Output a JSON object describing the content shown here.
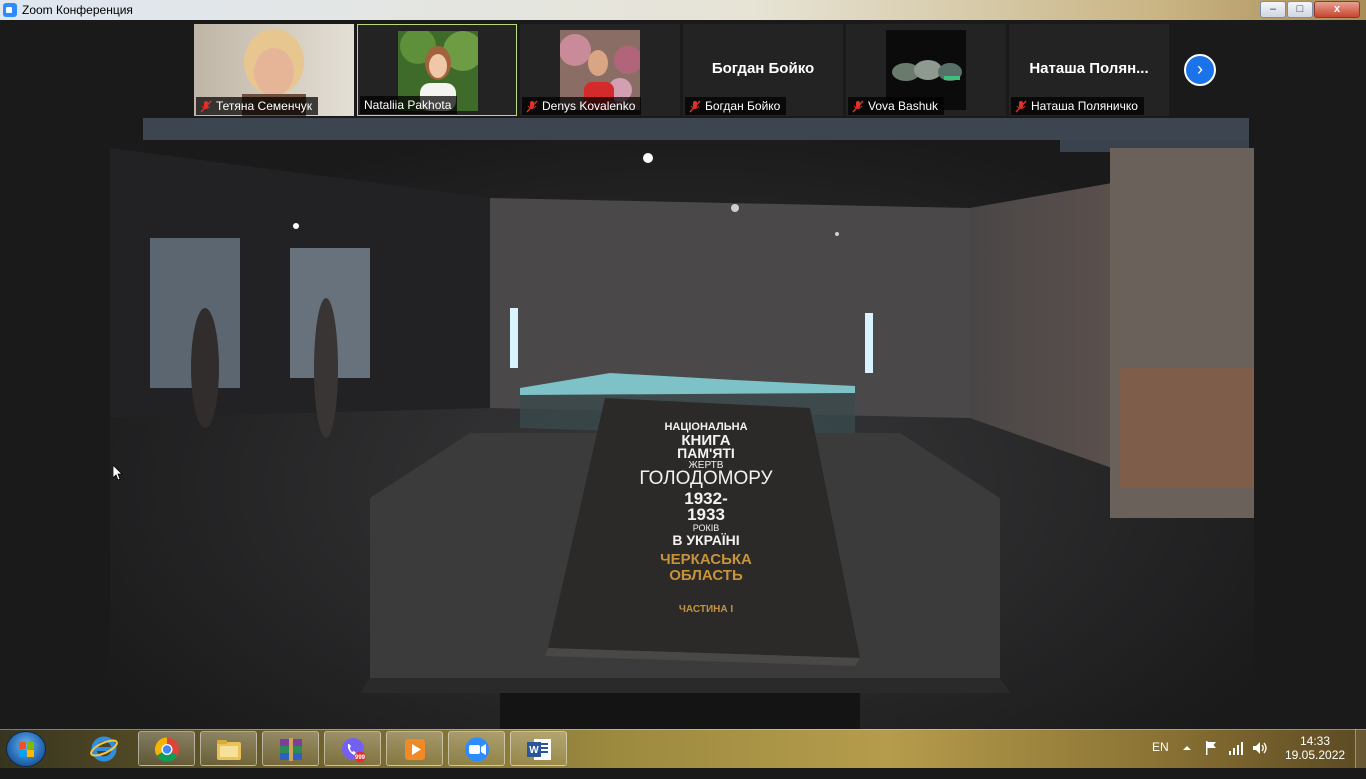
{
  "window": {
    "title": "Zoom Конференция",
    "controls": {
      "minimize": "–",
      "maximize": "□",
      "close": "x"
    }
  },
  "participants": [
    {
      "name": "Тетяна Семенчук",
      "muted": true,
      "video": "webcam"
    },
    {
      "name": "Nataliia Pakhota",
      "muted": false,
      "video": "photo",
      "active": true
    },
    {
      "name": "Denys Kovalenko",
      "muted": true,
      "video": "photo"
    },
    {
      "name": "Богдан Бойко",
      "muted": true,
      "video": "none",
      "display_name": "Богдан Бойко"
    },
    {
      "name": "Vova Bashuk",
      "muted": true,
      "video": "photo"
    },
    {
      "name": "Наташа Поляничко",
      "muted": true,
      "video": "none",
      "display_name": "Наташа  Полян..."
    }
  ],
  "gallery_next": "›",
  "shared_video": {
    "book": {
      "line1": "НАЦІОНАЛЬНА",
      "line2": "КНИГА",
      "line3": "ПАМ'ЯТІ",
      "line4": "ЖЕРТВ",
      "line5": "ГОЛОДОМОРУ",
      "line6": "1932-",
      "line7": "1933",
      "line8": "РОКІВ",
      "line9": "В УКРАЇНІ",
      "region1": "ЧЕРКАСЬКА",
      "region2": "ОБЛАСТЬ",
      "part": "ЧАСТИНА І"
    }
  },
  "taskbar": {
    "apps": [
      "internet-explorer",
      "chrome",
      "file-explorer",
      "winrar",
      "viber",
      "media-player",
      "zoom",
      "word"
    ],
    "viber_badge": "999",
    "language": "EN",
    "time": "14:33",
    "date": "19.05.2022"
  },
  "colors": {
    "zoom_blue": "#2d8cff",
    "active_speaker_border": "#b9d97a",
    "muted_red": "#e0312b",
    "book_gold": "#c7933a"
  }
}
